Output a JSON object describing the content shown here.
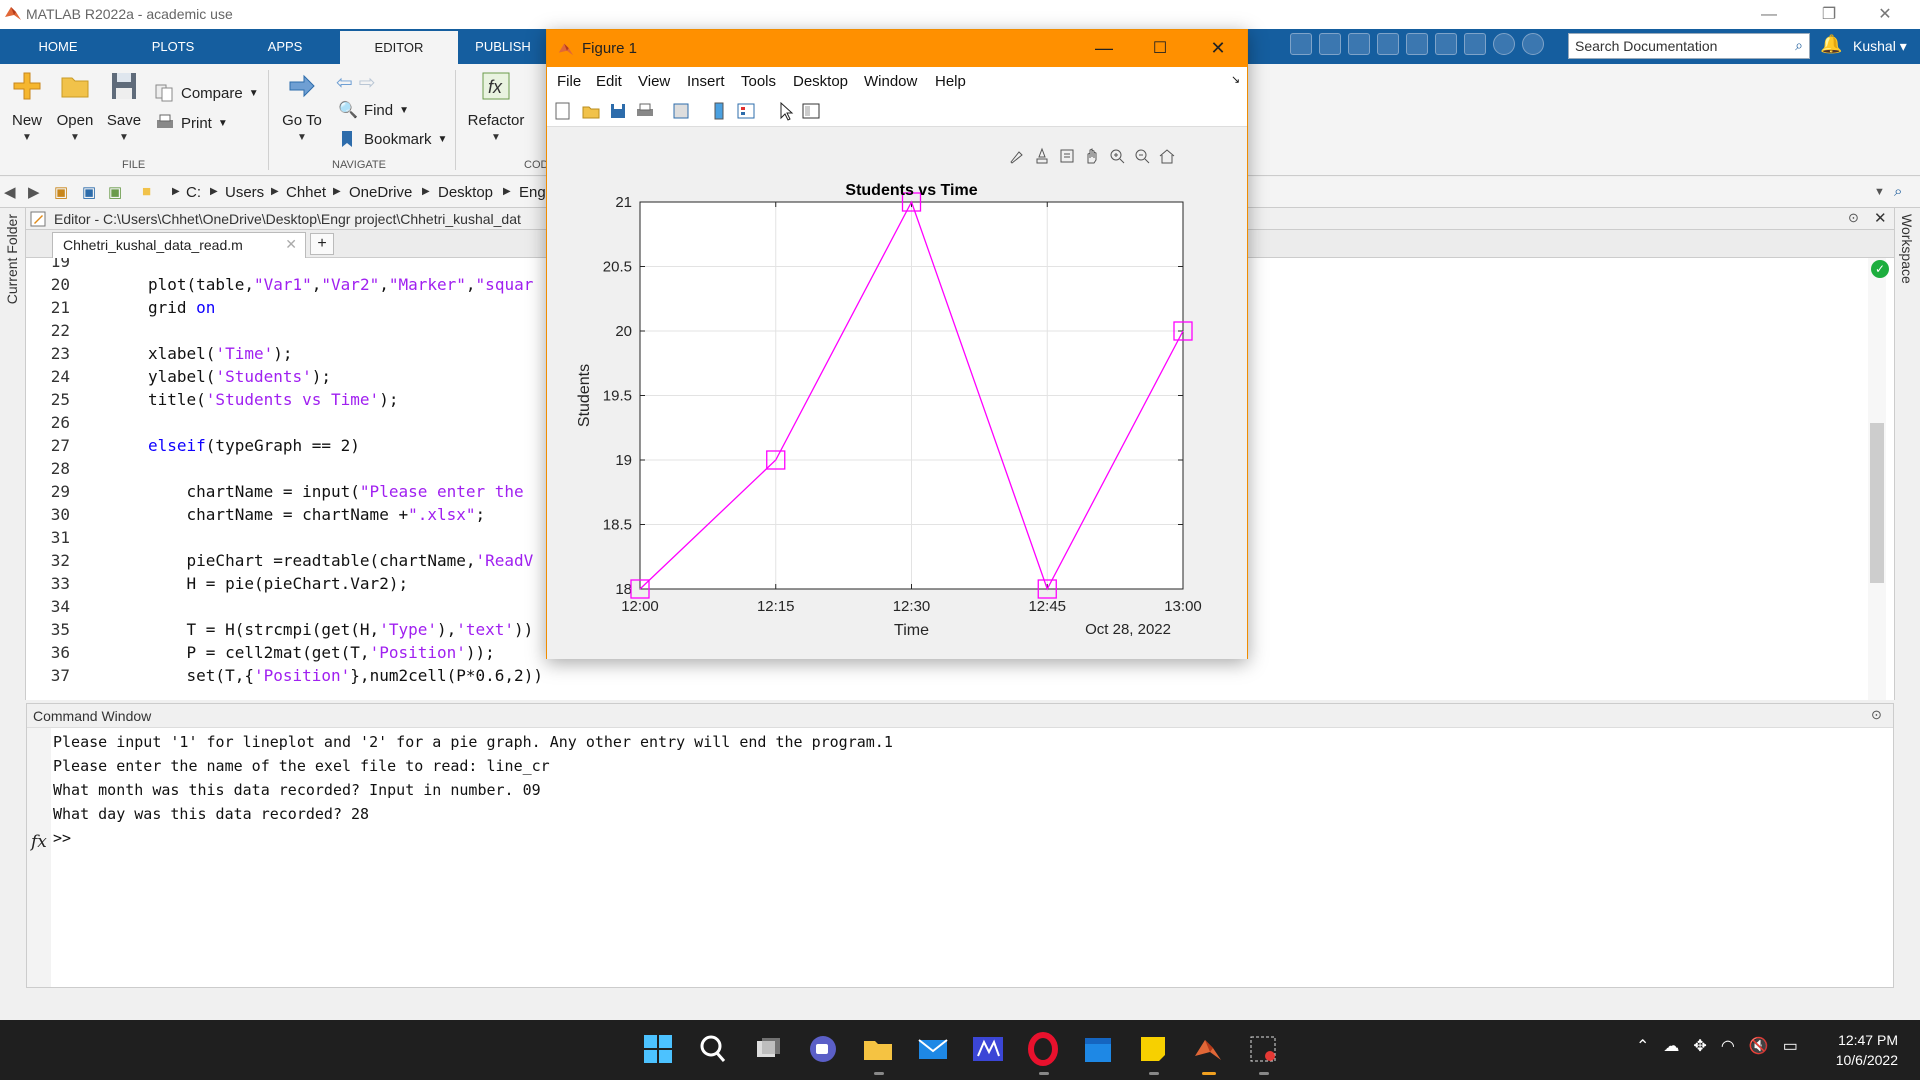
{
  "window": {
    "title": "MATLAB R2022a - academic use",
    "minimize": "—",
    "restore": "❐",
    "close": "✕"
  },
  "ribbon_tabs": [
    "HOME",
    "PLOTS",
    "APPS",
    "EDITOR",
    "PUBLISH"
  ],
  "active_tab": "EDITOR",
  "search": {
    "placeholder": "Search Documentation"
  },
  "user": "Kushal",
  "ribbon": {
    "file": {
      "group": "FILE",
      "new": "New",
      "open": "Open",
      "save": "Save",
      "compare": "Compare",
      "print": "Print"
    },
    "navigate": {
      "group": "NAVIGATE",
      "goto": "Go To",
      "find": "Find",
      "bookmark": "Bookmark"
    },
    "code": {
      "group": "COD",
      "refactor": "Refactor"
    }
  },
  "address": {
    "crumbs": [
      "C:",
      "Users",
      "Chhet",
      "OneDrive",
      "Desktop",
      "Engr"
    ]
  },
  "docks": {
    "left": "Current Folder",
    "right": "Workspace"
  },
  "editor": {
    "header": "Editor - C:\\Users\\Chhet\\OneDrive\\Desktop\\Engr project\\Chhetri_kushal_dat",
    "tab": "Chhetri_kushal_data_read.m",
    "tab_close": "✕",
    "add_tab": "+",
    "lines": [
      {
        "n": "19",
        "parts": []
      },
      {
        "n": "20",
        "parts": [
          [
            "t",
            "plot(table,"
          ],
          [
            "s",
            "\"Var1\""
          ],
          [
            "t",
            ","
          ],
          [
            "s",
            "\"Var2\""
          ],
          [
            "t",
            ","
          ],
          [
            "s",
            "\"Marker\""
          ],
          [
            "t",
            ","
          ],
          [
            "s",
            "\"squar"
          ]
        ]
      },
      {
        "n": "21",
        "parts": [
          [
            "t",
            "grid "
          ],
          [
            "k",
            "on"
          ]
        ]
      },
      {
        "n": "22",
        "parts": []
      },
      {
        "n": "23",
        "parts": [
          [
            "t",
            "xlabel("
          ],
          [
            "s",
            "'Time'"
          ],
          [
            "t",
            ");"
          ]
        ]
      },
      {
        "n": "24",
        "parts": [
          [
            "t",
            "ylabel("
          ],
          [
            "s",
            "'Students'"
          ],
          [
            "t",
            ");"
          ]
        ]
      },
      {
        "n": "25",
        "parts": [
          [
            "t",
            "title("
          ],
          [
            "s",
            "'Students vs Time'"
          ],
          [
            "t",
            ");"
          ]
        ]
      },
      {
        "n": "26",
        "parts": []
      },
      {
        "n": "27",
        "parts": [
          [
            "k",
            "elseif"
          ],
          [
            "t",
            "(typeGraph == 2)"
          ]
        ]
      },
      {
        "n": "28",
        "parts": []
      },
      {
        "n": "29",
        "parts": [
          [
            "t",
            "    chartName = input("
          ],
          [
            "s",
            "\"Please enter the"
          ]
        ]
      },
      {
        "n": "30",
        "parts": [
          [
            "t",
            "    chartName = chartName +"
          ],
          [
            "s",
            "\".xlsx\""
          ],
          [
            "t",
            ";"
          ]
        ]
      },
      {
        "n": "31",
        "parts": []
      },
      {
        "n": "32",
        "parts": [
          [
            "t",
            "    pieChart =readtable(chartName,"
          ],
          [
            "s",
            "'ReadV"
          ]
        ]
      },
      {
        "n": "33",
        "parts": [
          [
            "t",
            "    H = pie(pieChart.Var2);"
          ]
        ]
      },
      {
        "n": "34",
        "parts": []
      },
      {
        "n": "35",
        "parts": [
          [
            "t",
            "    T = H(strcmpi(get(H,"
          ],
          [
            "s",
            "'Type'"
          ],
          [
            "t",
            "),"
          ],
          [
            "s",
            "'text'"
          ],
          [
            "t",
            "))"
          ]
        ]
      },
      {
        "n": "36",
        "parts": [
          [
            "t",
            "    P = cell2mat(get(T,"
          ],
          [
            "s",
            "'Position'"
          ],
          [
            "t",
            "));"
          ]
        ]
      },
      {
        "n": "37",
        "parts": [
          [
            "t",
            "    set(T,{"
          ],
          [
            "s",
            "'Position'"
          ],
          [
            "t",
            "},num2cell(P*0.6,2))"
          ]
        ]
      }
    ]
  },
  "command_window": {
    "title": "Command Window",
    "lines": [
      "Please input '1' for lineplot and '2' for a pie graph. Any other entry will end the program.1",
      "Please enter the name of the exel file to read: line_cr",
      "What month was this data recorded? Input in number. 09",
      "What day was this data recorded? 28",
      ">>"
    ],
    "fx": "fx"
  },
  "figure": {
    "title": "Figure 1",
    "menu": [
      "File",
      "Edit",
      "View",
      "Insert",
      "Tools",
      "Desktop",
      "Window",
      "Help"
    ]
  },
  "chart_data": {
    "type": "line",
    "title": "Students vs Time",
    "xlabel": "Time",
    "ylabel": "Students",
    "x": [
      "12:00",
      "12:15",
      "12:30",
      "12:45",
      "13:00"
    ],
    "x_tick_labels": [
      "12:00",
      "12:15",
      "12:30",
      "12:45",
      "13:00"
    ],
    "x_secondary_label": "Oct 28, 2022",
    "series": [
      {
        "values": [
          18,
          19,
          21,
          18,
          20
        ],
        "color": "#ff00ff",
        "marker": "square"
      }
    ],
    "ylim": [
      18,
      21
    ],
    "y_ticks": [
      "18",
      "18.5",
      "19",
      "19.5",
      "20",
      "20.5",
      "21"
    ],
    "grid": true
  },
  "taskbar": {
    "time": "12:47 PM",
    "date": "10/6/2022"
  },
  "colors": {
    "ribbon_tab_bar": "#155e9f",
    "figure_titlebar": "#ff9000",
    "plot_line": "#ff00ff",
    "string": "#a020f0",
    "keyword": "#0e00ff"
  }
}
